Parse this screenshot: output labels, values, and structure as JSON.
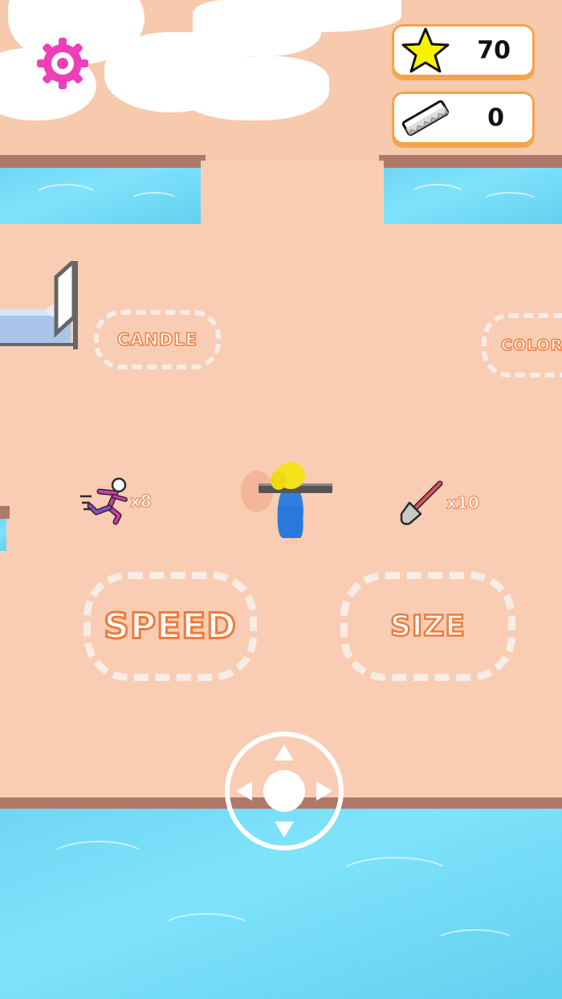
{
  "hud": {
    "settings_icon": "gear-icon",
    "stars": {
      "icon": "star-icon",
      "value": "70"
    },
    "saws": {
      "icon": "saw-blade-icon",
      "value": "0"
    }
  },
  "zones": {
    "candle": {
      "label": "CANDLE"
    },
    "color": {
      "label": "COLOR"
    },
    "speed": {
      "label": "SPEED"
    },
    "size": {
      "label": "SIZE"
    }
  },
  "pickups": {
    "speed": {
      "icon": "running-person-icon",
      "multiplier": "x8"
    },
    "shovel": {
      "icon": "shovel-icon",
      "multiplier": "x10"
    }
  },
  "colors": {
    "accent_orange": "#f07a3a",
    "sand": "#f9cdb3",
    "water": "#7fe3fb",
    "settings_pink": "#ee3fb8"
  }
}
